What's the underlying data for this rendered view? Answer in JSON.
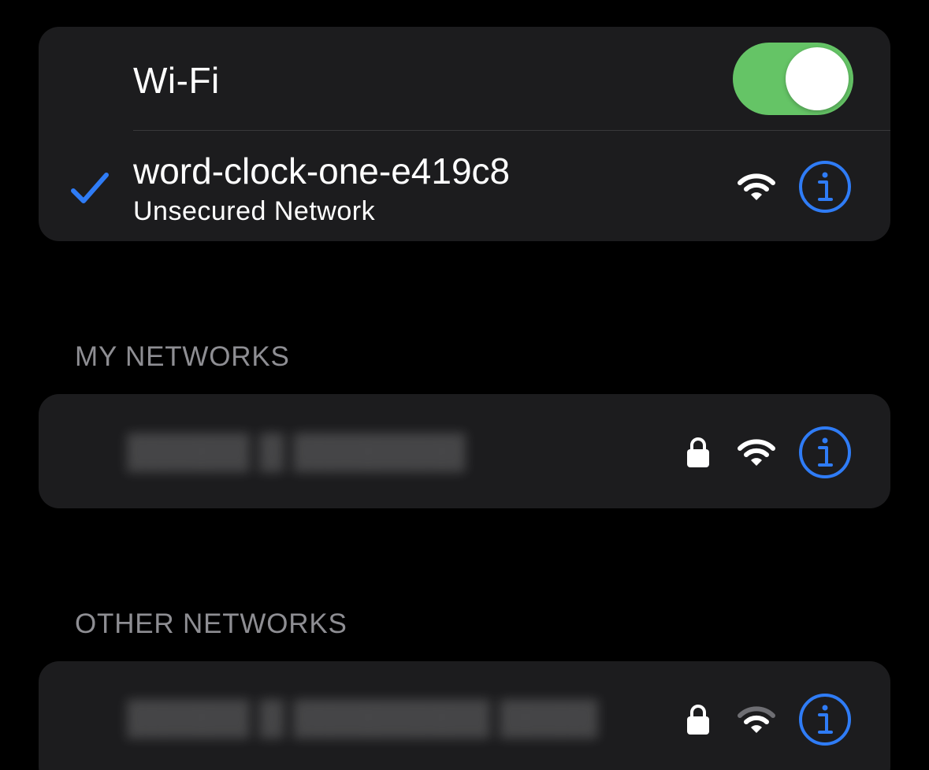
{
  "colors": {
    "accent": "#2f7cf6",
    "toggle_on": "#65c466",
    "card_bg": "#1c1c1e",
    "section_text": "#8e8e93",
    "wifi_icon_dim": "#8e8e93"
  },
  "wifi": {
    "label": "Wi-Fi",
    "enabled": true
  },
  "connected": {
    "name": "word-clock-one-e419c8",
    "subtitle": "Unsecured Network",
    "icons": [
      "checkmark-icon",
      "wifi-signal-icon",
      "info-icon"
    ]
  },
  "sections": {
    "my_networks": "MY NETWORKS",
    "other_networks": "OTHER NETWORKS"
  },
  "my_networks": [
    {
      "name": "Redacted network name",
      "secured": true,
      "icons": [
        "lock-icon",
        "wifi-signal-icon",
        "info-icon"
      ]
    }
  ],
  "other_networks": [
    {
      "name": "Redacted network name",
      "secured": true,
      "icons": [
        "lock-icon",
        "wifi-signal-icon",
        "info-icon"
      ]
    }
  ]
}
